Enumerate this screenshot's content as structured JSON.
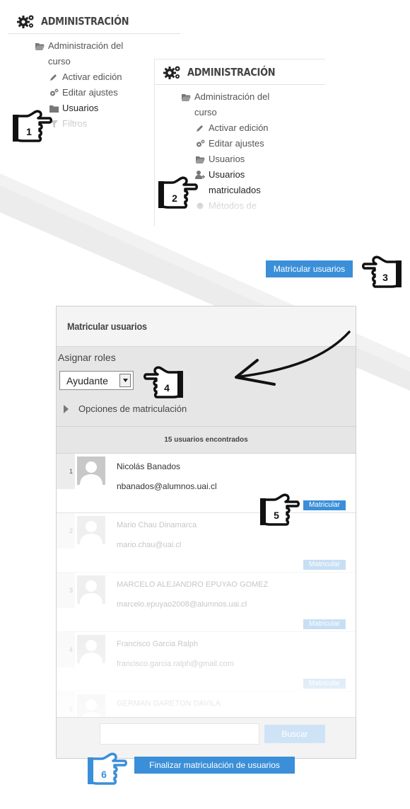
{
  "panel1": {
    "title": "ADMINISTRACIÓN",
    "items": [
      {
        "label": "Administración del curso",
        "icon": "folder-open-icon"
      },
      {
        "label": "Activar edición",
        "icon": "pencil-icon"
      },
      {
        "label": "Editar ajustes",
        "icon": "cogs-icon"
      },
      {
        "label": "Usuarios",
        "icon": "folder-icon"
      },
      {
        "label": "Filtros",
        "icon": "filter-icon"
      }
    ]
  },
  "panel2": {
    "title": "ADMINISTRACIÓN",
    "items": [
      {
        "label": "Administración del curso",
        "icon": "folder-open-icon"
      },
      {
        "label": "Activar edición",
        "icon": "pencil-icon"
      },
      {
        "label": "Editar ajustes",
        "icon": "cogs-icon"
      },
      {
        "label": "Usuarios",
        "icon": "folder-open-icon"
      },
      {
        "label": "Usuarios matriculados",
        "icon": "user-plus-icon"
      },
      {
        "label": "Métodos de",
        "icon": "circle-icon"
      }
    ]
  },
  "enrol_button": {
    "label": "Matricular usuarios"
  },
  "dialog": {
    "title": "Matricular usuarios",
    "assign_roles_label": "Asignar roles",
    "role_selected": "Ayudante",
    "options_label": "Opciones de matriculación",
    "found_text": "15 usuarios encontrados",
    "enrol_label": "Matricular",
    "search_button": "Buscar",
    "search_value": "",
    "finish_button": "Finalizar matriculación de usuarios",
    "users": [
      {
        "num": "1",
        "name": "Nicolás Banados",
        "email": "nbanados@alumnos.uai.cl"
      },
      {
        "num": "2",
        "name": "Mario Chau Dinamarca",
        "email": "mario.chau@uai.cl"
      },
      {
        "num": "3",
        "name": "MARCELO ALEJANDRO EPUYAO GOMEZ",
        "email": "marcelo.epuyao2008@alumnos.uai.cl"
      },
      {
        "num": "4",
        "name": "Francisco Garcia Ralph",
        "email": "francisco.garcia.ralph@gmail.com"
      },
      {
        "num": "5",
        "name": "GERMAN GARETON DAVILA",
        "email": ""
      }
    ]
  },
  "steps": [
    "1",
    "2",
    "3",
    "4",
    "5",
    "6"
  ],
  "colors": {
    "accent": "#3a8fd8",
    "hand": "#111111",
    "hand_blue": "#3a8fd8"
  }
}
